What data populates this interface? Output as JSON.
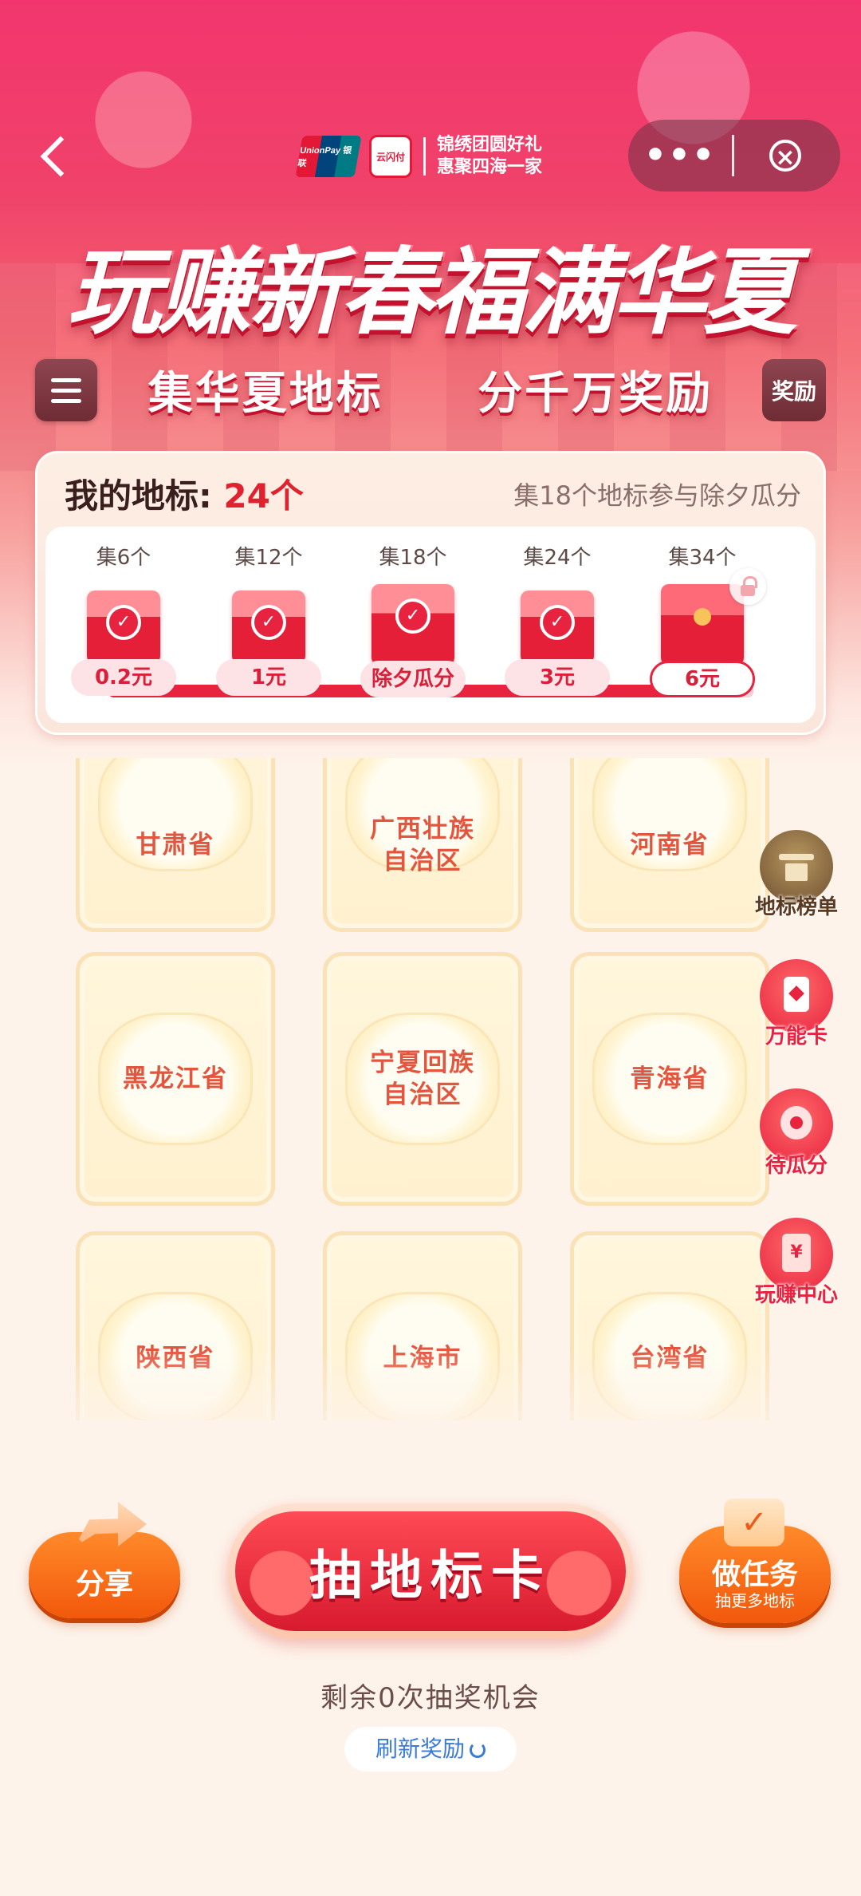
{
  "header": {
    "brand_logo_unionpay": "UnionPay 银联",
    "brand_logo_yunshanfu": "云闪付",
    "brand_slogan_line1": "锦绣团圆好礼",
    "brand_slogan_line2": "惠聚四海一家",
    "capsule_more": "•••",
    "capsule_close": "×",
    "title": "玩赚新春福满华夏",
    "subtitle_left": "集华夏地标",
    "subtitle_right": "分千万奖励",
    "reward_label": "奖励"
  },
  "progress": {
    "label": "我的地标:",
    "count": "24个",
    "hint": "集18个地标参与除夕瓜分",
    "milestones": [
      {
        "label": "集6个",
        "reward": "0.2元",
        "done": true
      },
      {
        "label": "集12个",
        "reward": "1元",
        "done": true
      },
      {
        "label": "集18个",
        "reward": "除夕瓜分",
        "done": true
      },
      {
        "label": "集24个",
        "reward": "3元",
        "done": true
      },
      {
        "label": "集34个",
        "reward": "6元",
        "done": false
      }
    ]
  },
  "cards": [
    "甘肃省",
    "广西壮族\n自治区",
    "河南省",
    "黑龙江省",
    "宁夏回族\n自治区",
    "青海省",
    "陕西省",
    "上海市",
    "台湾省"
  ],
  "side_buttons": {
    "rank": "地标榜单",
    "wild_card": "万能卡",
    "pending": "待瓜分",
    "center": "玩赚中心",
    "center_icon": "¥"
  },
  "actions": {
    "share": "分享",
    "draw": "抽地标卡",
    "task": "做任务",
    "task_sub": "抽更多地标",
    "chances": "剩余0次抽奖机会",
    "refresh": "刷新奖励"
  },
  "colors": {
    "primary_red": "#e8233f",
    "orange": "#f2580b",
    "card_text": "#e4553f"
  },
  "icons": {
    "back": "chevron-left-icon",
    "menu": "hamburger-icon",
    "check": "check-icon",
    "lock": "lock-icon",
    "refresh": "refresh-icon"
  }
}
